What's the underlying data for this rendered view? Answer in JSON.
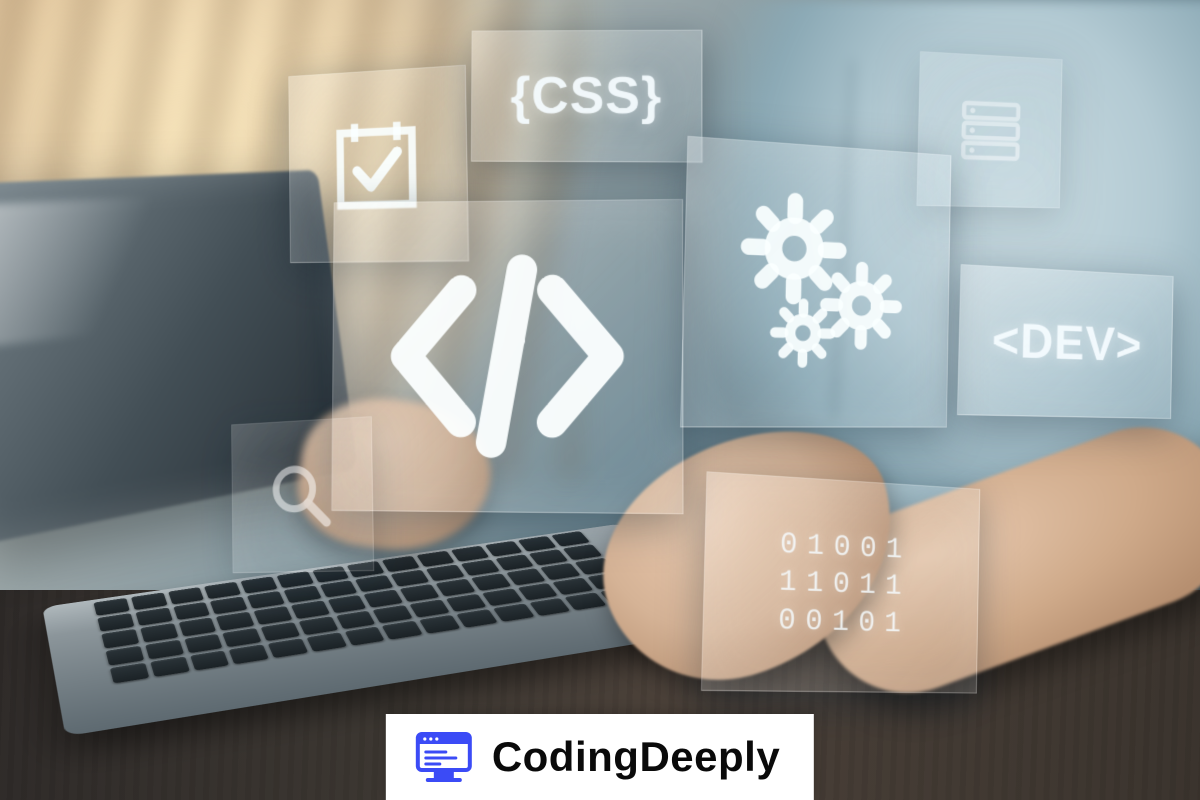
{
  "panes": {
    "css_label": "{CSS}",
    "dev_label": "<DEV>",
    "binary_row1": "01001",
    "binary_row2": "11011",
    "binary_row3": "00101"
  },
  "brand": {
    "name": "CodingDeeply"
  }
}
